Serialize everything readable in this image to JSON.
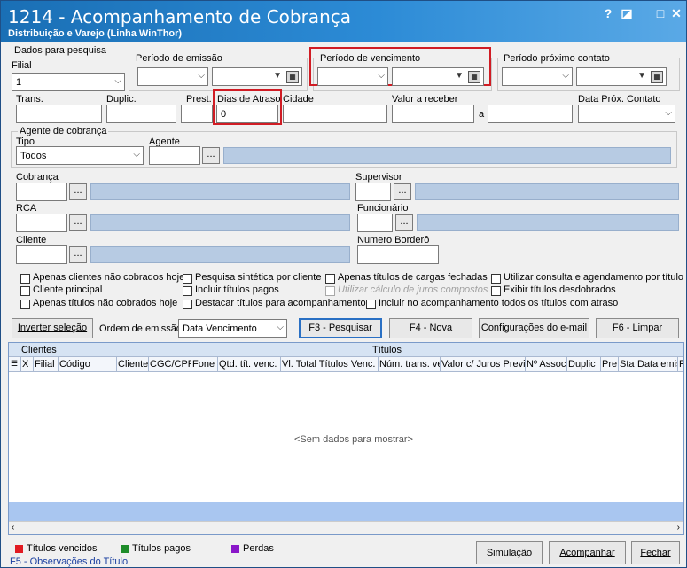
{
  "window": {
    "title": "1214 - Acompanhamento de Cobrança",
    "subtitle": "Distribuição e Varejo (Linha WinThor)",
    "help": "?",
    "restore": "◪",
    "minimize": "_",
    "maximize": "□",
    "close": "✕"
  },
  "filters": {
    "group_title": "Dados para pesquisa",
    "filial_label": "Filial",
    "filial_value": "1",
    "emissao_label": "Período de emissão",
    "vencimento_label": "Período de vencimento",
    "proximo_contato_label": "Período próximo contato",
    "trans_label": "Trans.",
    "duplic_label": "Duplic.",
    "prest_label": "Prest.",
    "dias_atraso_label": "Dias de Atraso",
    "dias_atraso_value": "0",
    "cidade_label": "Cidade",
    "valor_receber_label": "Valor a receber",
    "a_label": "a",
    "data_prox_label": "Data Próx. Contato",
    "agente_group_title": "Agente de cobrança",
    "tipo_label": "Tipo",
    "tipo_value": "Todos",
    "agente_label": "Agente",
    "cobranca_label": "Cobrança",
    "supervisor_label": "Supervisor",
    "rca_label": "RCA",
    "funcionario_label": "Funcionário",
    "cliente_label": "Cliente",
    "bordero_label": "Numero Borderô",
    "dots": "..."
  },
  "options": [
    "Apenas clientes não cobrados hoje",
    "Cliente principal",
    "Apenas títulos não cobrados hoje",
    "Pesquisa sintética por cliente",
    "Incluir títulos pagos",
    "Destacar títulos para acompanhamento",
    "Apenas títulos de cargas fechadas",
    "Utilizar cálculo de juros compostos",
    "Incluir no acompanhamento todos os títulos com atraso",
    "Utilizar consulta e agendamento por título",
    "Exibir títulos desdobrados"
  ],
  "actions": {
    "inverter": "Inverter seleção",
    "ordem_label": "Ordem de emissão",
    "ordem_value": "Data Vencimento",
    "pesquisar": "F3 - Pesquisar",
    "nova": "F4 - Nova",
    "config_email": "Configurações do e-mail",
    "limpar": "F6 - Limpar"
  },
  "grid": {
    "band_clientes": "Clientes",
    "band_titulos": "Títulos",
    "empty": "<Sem dados para mostrar>",
    "columns": [
      "X",
      "Filial",
      "Código",
      "Cliente",
      "CGC/CPF",
      "Fone",
      "Qtd. tít. venc.",
      "Vl. Total Títulos Venc.",
      "Núm. trans. ve",
      "Valor c/ Juros Previs",
      "Nº Assoc",
      "Duplic",
      "Pre",
      "Sta",
      "Data emis",
      "P"
    ]
  },
  "legend": {
    "vencidos": "Títulos vencidos",
    "pagos": "Títulos pagos",
    "perdas": "Perdas",
    "colors": {
      "vencidos": "#e11b22",
      "pagos": "#1e8c2a",
      "perdas": "#8a17c9"
    }
  },
  "footer": {
    "simulacao": "Simulação",
    "acompanhar": "Acompanhar",
    "fechar": "Fechar",
    "f5": "F5 - Observações do Título"
  }
}
